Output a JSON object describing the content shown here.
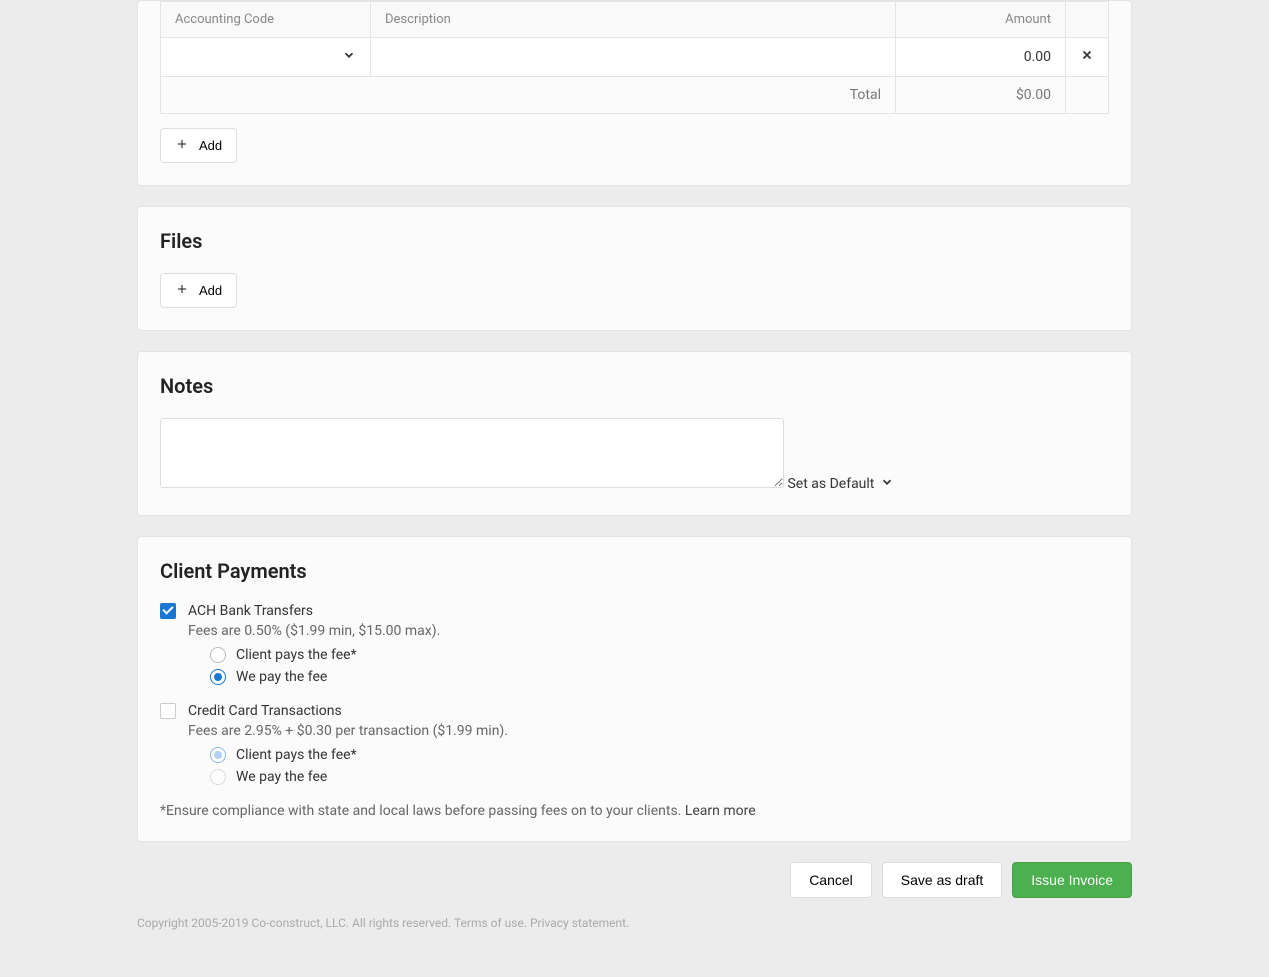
{
  "line_items": {
    "headers": {
      "code": "Accounting Code",
      "description": "Description",
      "amount": "Amount"
    },
    "rows": [
      {
        "code": "",
        "description": "",
        "amount": "0.00"
      }
    ],
    "total_label": "Total",
    "total_value": "$0.00",
    "add_label": "Add"
  },
  "files": {
    "title": "Files",
    "add_label": "Add"
  },
  "notes": {
    "title": "Notes",
    "value": "",
    "set_default": "Set as Default"
  },
  "payments": {
    "title": "Client Payments",
    "ach": {
      "label": "ACH Bank Transfers",
      "fees": "Fees are 0.50% ($1.99 min, $15.00 max).",
      "checked": true,
      "options": {
        "client": "Client pays the fee*",
        "we": "We pay the fee",
        "selected": "we"
      }
    },
    "cc": {
      "label": "Credit Card Transactions",
      "fees": "Fees are 2.95% + $0.30 per transaction ($1.99 min).",
      "checked": false,
      "options": {
        "client": "Client pays the fee*",
        "we": "We pay the fee",
        "selected": "client"
      }
    },
    "compliance": "*Ensure compliance with state and local laws before passing fees on to your clients. ",
    "learn_more": "Learn more"
  },
  "actions": {
    "cancel": "Cancel",
    "save_draft": "Save as draft",
    "issue": "Issue Invoice"
  },
  "footer": {
    "copyright": "Copyright 2005-2019 Co-construct, LLC. All rights reserved.",
    "terms": "Terms of use.",
    "privacy": "Privacy statement."
  }
}
